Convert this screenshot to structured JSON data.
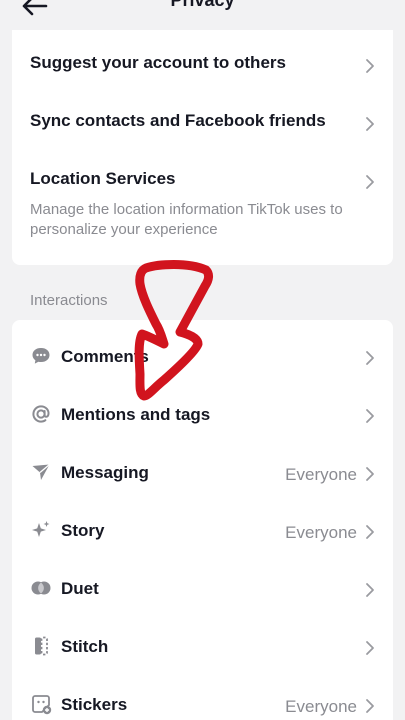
{
  "header": {
    "title": "Privacy"
  },
  "discoverability": {
    "items": [
      {
        "label": "Suggest your account to others"
      },
      {
        "label": "Sync contacts and Facebook friends"
      },
      {
        "label": "Location Services",
        "description": "Manage the location information TikTok uses to personalize your experience"
      }
    ]
  },
  "interactions": {
    "section_label": "Interactions",
    "items": [
      {
        "label": "Comments",
        "value": "",
        "icon": "comment-icon"
      },
      {
        "label": "Mentions and tags",
        "value": "",
        "icon": "at-icon"
      },
      {
        "label": "Messaging",
        "value": "Everyone",
        "icon": "send-icon"
      },
      {
        "label": "Story",
        "value": "Everyone",
        "icon": "sparkle-icon"
      },
      {
        "label": "Duet",
        "value": "",
        "icon": "duet-icon"
      },
      {
        "label": "Stitch",
        "value": "",
        "icon": "stitch-icon"
      },
      {
        "label": "Stickers",
        "value": "Everyone",
        "icon": "sticker-icon"
      }
    ]
  },
  "colors": {
    "accent_annotation": "#d1141e",
    "muted_text": "#8a8b91",
    "background": "#f2f2f3"
  }
}
